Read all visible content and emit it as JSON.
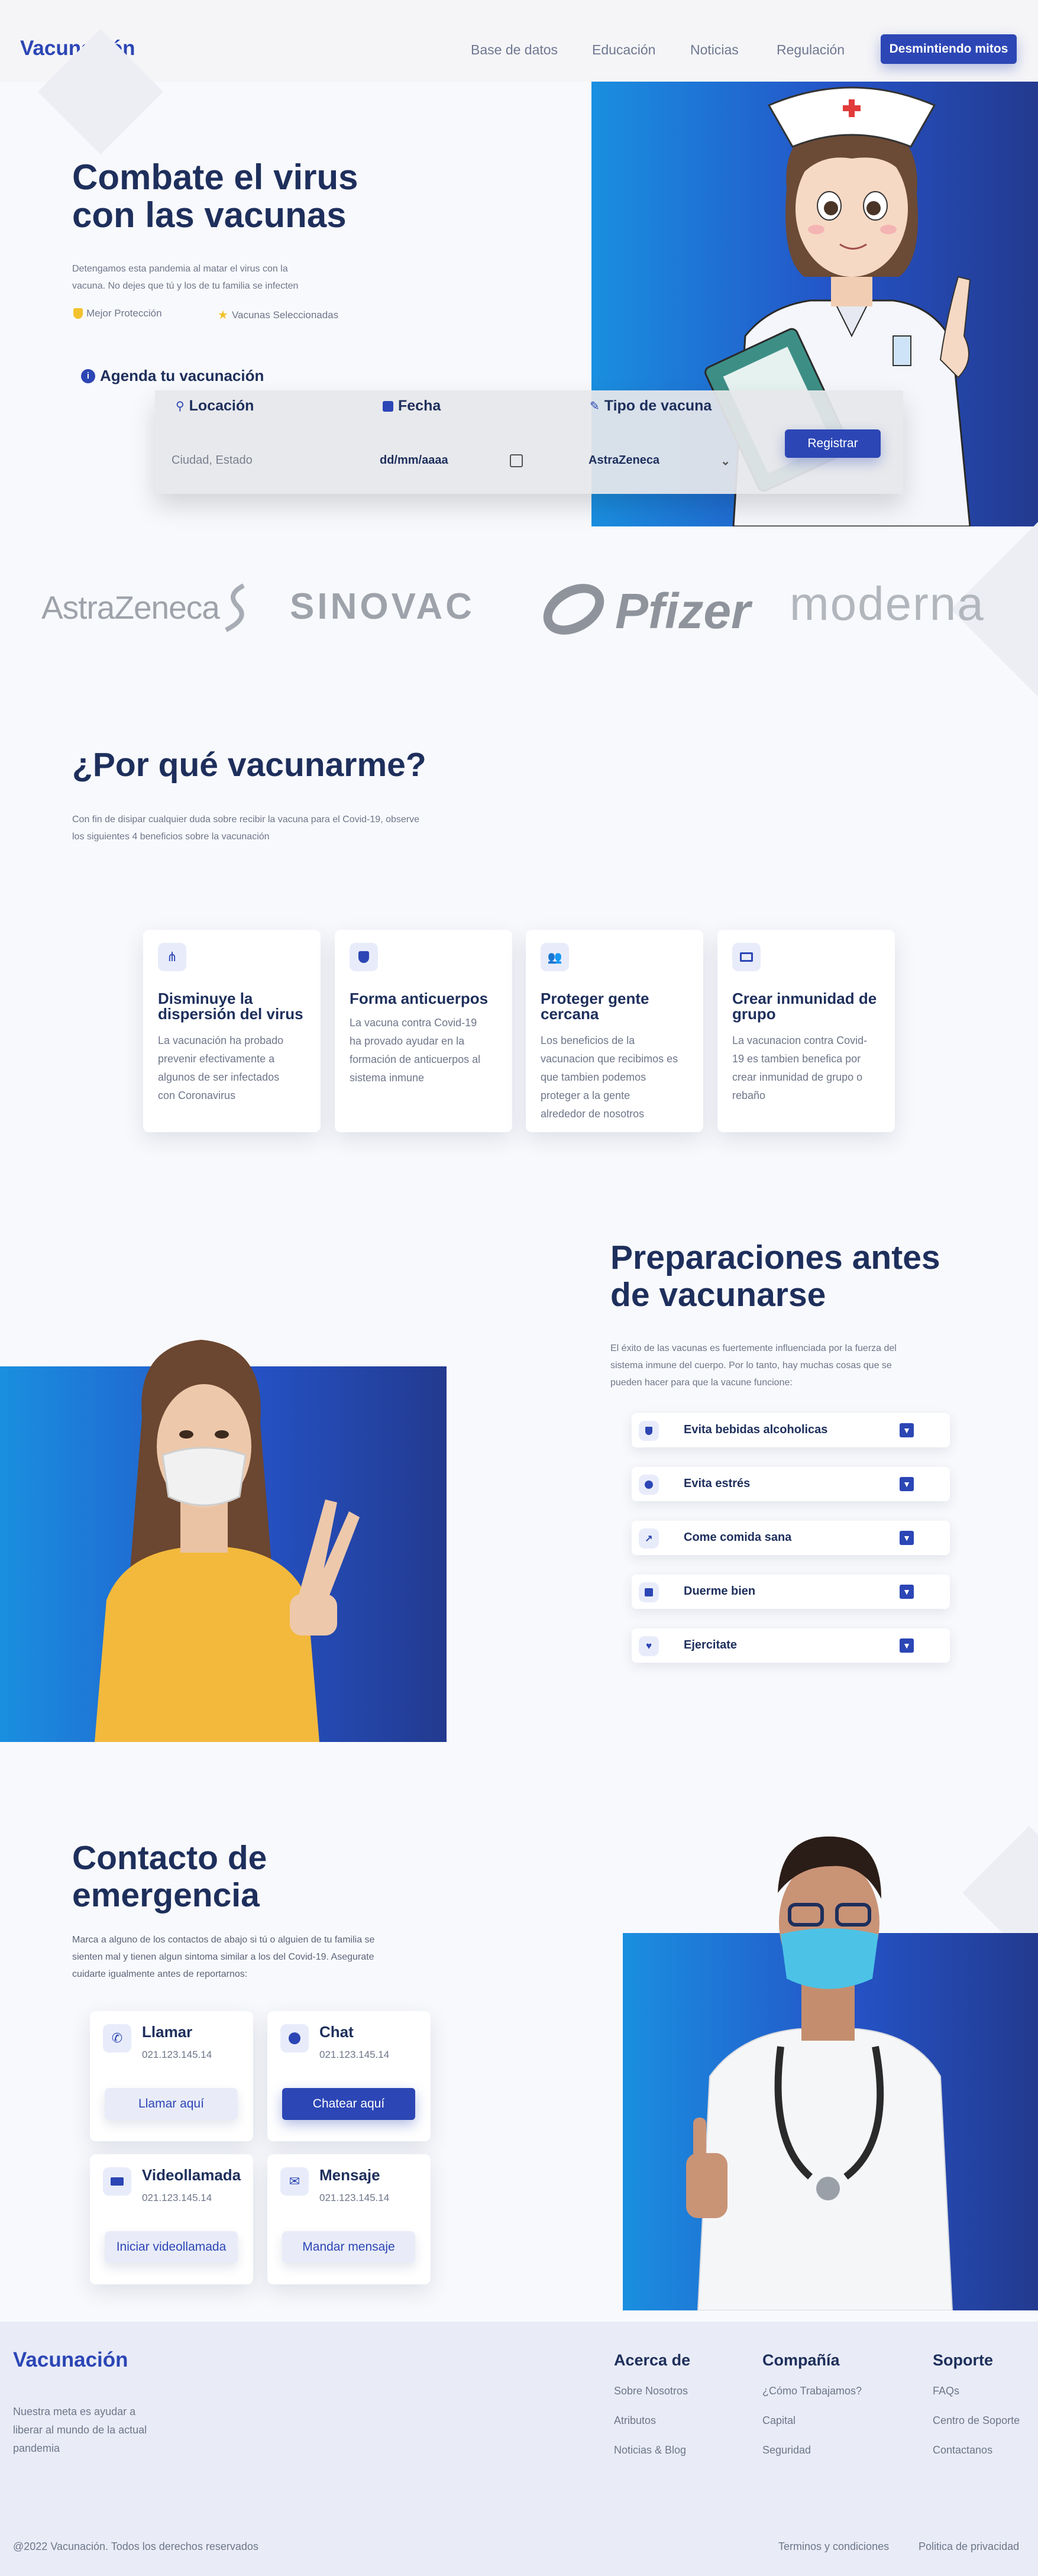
{
  "nav": {
    "logo": "Vacunación",
    "links": [
      "Base de datos",
      "Educación",
      "Noticias",
      "Regulación"
    ],
    "cta": "Desmintiendo mitos"
  },
  "hero": {
    "title_line1": "Combate el virus",
    "title_line2": "con las vacunas",
    "desc_line1": "Detengamos esta pandemia al matar el virus con la",
    "desc_line2": "vacuna. No dejes que tú y los de tu familia se infecten",
    "feature1": "Mejor Protección",
    "feature2": "Vacunas Seleccionadas",
    "booking_title": "Agenda tu vacunación",
    "booking": {
      "location_label": "Locación",
      "location_placeholder": "Ciudad, Estado",
      "date_label": "Fecha",
      "date_placeholder": "dd/mm/aaaa",
      "type_label": "Tipo de vacuna",
      "type_value": "AstraZeneca",
      "submit": "Registrar"
    }
  },
  "brands": [
    "AstraZeneca",
    "SINOVAC",
    "Pfizer",
    "moderna"
  ],
  "why": {
    "title": "¿Por qué vacunarme?",
    "desc_line1": "Con fin de disipar cualquier duda sobre recibir la vacuna para el Covid-19, observe",
    "desc_line2": "los siguientes 4 beneficios sobre la vacunación",
    "cards": [
      {
        "title1": "Disminuye la",
        "title2": "dispersión del virus",
        "lines": [
          "La vacunación ha probado",
          "prevenir efectivamente a",
          "algunos de ser infectados",
          "con Coronavirus"
        ]
      },
      {
        "title1": "Forma anticuerpos",
        "title2": "",
        "lines": [
          "La vacuna contra Covid-19",
          "ha provado ayudar en la",
          "formación de anticuerpos al",
          "sistema inmune"
        ]
      },
      {
        "title1": "Proteger gente",
        "title2": "cercana",
        "lines": [
          "Los beneficios de la",
          "vacunacion que recibimos es",
          "que tambien podemos",
          "proteger a la gente",
          "alrededor de nosotros"
        ]
      },
      {
        "title1": "Crear inmunidad de",
        "title2": "grupo",
        "lines": [
          "La vacunacion contra Covid-",
          "19 es tambien benefica por",
          "crear inmunidad de grupo o",
          "rebaño"
        ]
      }
    ]
  },
  "prep": {
    "title_line1": "Preparaciones antes",
    "title_line2": "de vacunarse",
    "desc_line1": "El éxito de las vacunas es fuertemente influenciada por la fuerza del",
    "desc_line2": "sistema inmune del cuerpo. Por lo tanto, hay muchas cosas que se",
    "desc_line3": "pueden hacer para que la vacune funcione:",
    "items": [
      "Evita bebidas alcoholicas",
      "Evita estrés",
      "Come comida sana",
      "Duerme bien",
      "Ejercitate"
    ]
  },
  "contact": {
    "title_line1": "Contacto de",
    "title_line2": "emergencia",
    "desc_line1": "Marca a alguno de los contactos de abajo si tú o alguien de tu familia se",
    "desc_line2": "sienten mal y tienen algun sintoma similar a los del Covid-19. Asegurate",
    "desc_line3": "cuidarte igualmente antes de reportarnos:",
    "cards": [
      {
        "title": "Llamar",
        "phone": "021.123.145.14",
        "button": "Llamar aquí"
      },
      {
        "title": "Chat",
        "phone": "021.123.145.14",
        "button": "Chatear aquí"
      },
      {
        "title": "Videollamada",
        "phone": "021.123.145.14",
        "button": "Iniciar videollamada"
      },
      {
        "title": "Mensaje",
        "phone": "021.123.145.14",
        "button": "Mandar mensaje"
      }
    ]
  },
  "footer": {
    "logo": "Vacunación",
    "tagline": [
      "Nuestra meta es ayudar a",
      "liberar al mundo de la actual",
      "pandemia"
    ],
    "cols": [
      {
        "title": "Acerca de",
        "links": [
          "Sobre Nosotros",
          "Atributos",
          "Noticias & Blog"
        ]
      },
      {
        "title": "Compañía",
        "links": [
          "¿Cómo Trabajamos?",
          "Capital",
          "Seguridad"
        ]
      },
      {
        "title": "Soporte",
        "links": [
          "FAQs",
          "Centro de Soporte",
          "Contactanos"
        ]
      }
    ],
    "copyright": "@2022 Vacunación. Todos los derechos reservados",
    "legal1": "Terminos y condiciones",
    "legal2": "Politica de privacidad"
  },
  "colors": {
    "primary": "#2c46b5",
    "navy": "#1e2f5c",
    "accent_gold": "#f2c12e"
  }
}
